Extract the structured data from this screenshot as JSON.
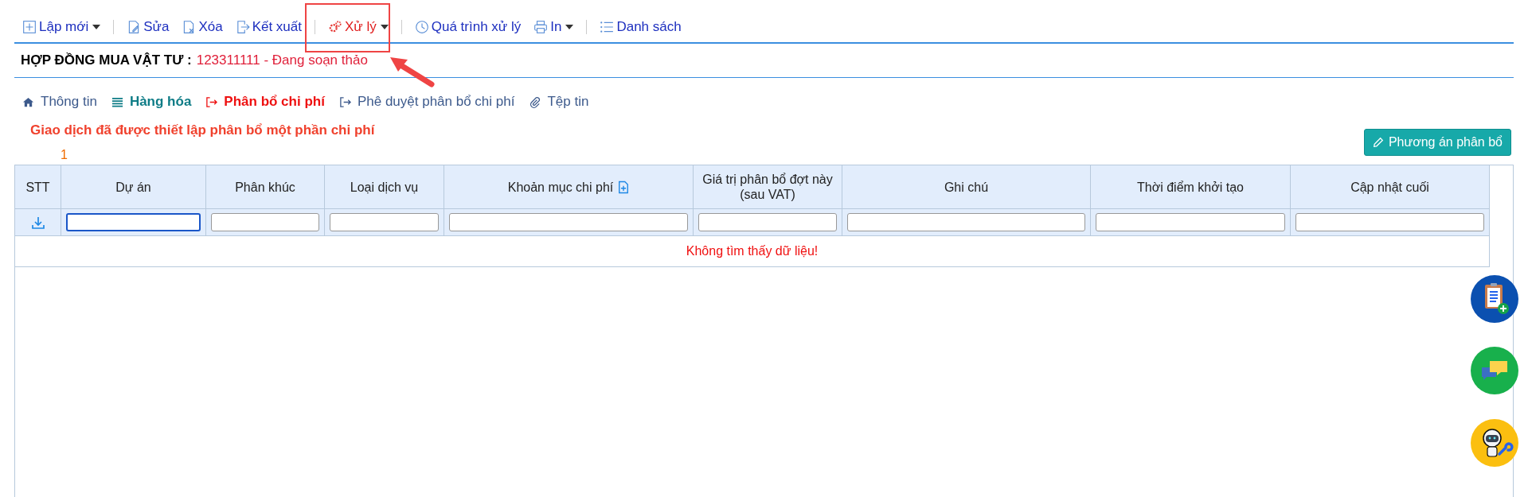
{
  "toolbar": {
    "groups": [
      [
        {
          "label": "Lập mới",
          "dropdown": true,
          "highlighted": false
        }
      ],
      [
        {
          "label": "Sửa",
          "dropdown": false,
          "highlighted": false
        },
        {
          "label": "Xóa",
          "dropdown": false,
          "highlighted": false
        },
        {
          "label": "Kết xuất",
          "dropdown": false,
          "highlighted": false
        }
      ],
      [
        {
          "label": "Xử lý",
          "dropdown": true,
          "highlighted": true
        }
      ],
      [
        {
          "label": "Quá trình xử lý",
          "dropdown": false,
          "highlighted": false
        },
        {
          "label": "In",
          "dropdown": true,
          "highlighted": false
        }
      ],
      [
        {
          "label": "Danh sách",
          "dropdown": false,
          "highlighted": false
        }
      ]
    ]
  },
  "header": {
    "title": "HỢP ĐỒNG MUA VẬT TƯ :",
    "value": "123311111 - Đang soạn thảo"
  },
  "tabs": [
    {
      "label": "Thông tin",
      "selected": false,
      "filled": false
    },
    {
      "label": "Hàng hóa",
      "selected": false,
      "filled": true
    },
    {
      "label": "Phân bổ chi phí",
      "selected": true,
      "filled": false
    },
    {
      "label": "Phê duyệt phân bổ chi phí",
      "selected": false,
      "filled": false
    },
    {
      "label": "Tệp tin",
      "selected": false,
      "filled": false
    }
  ],
  "message": "Giao dịch đã được thiết lập phân bổ một phần chi phí",
  "count": "1",
  "plan_button": "Phương án phân bổ",
  "table": {
    "columns": [
      "STT",
      "Dự án",
      "Phân khúc",
      "Loại dịch vụ",
      "Khoản mục chi phí",
      "Giá trị phân bổ đợt này (sau VAT)",
      "Ghi chú",
      "Thời điểm khởi tạo",
      "Cập nhật cuối"
    ],
    "empty_message": "Không tìm thấy dữ liệu!"
  }
}
